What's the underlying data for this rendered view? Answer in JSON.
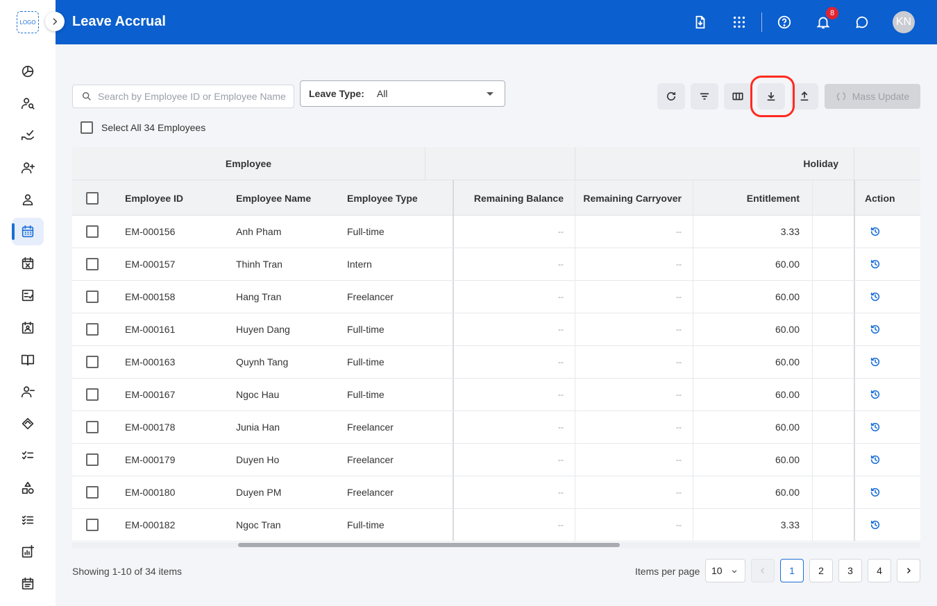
{
  "brand": {
    "logo_text": "LOGO",
    "primary_color": "#0b5fce",
    "accent_color": "#1a6fd6",
    "highlight_color": "#ff2a1f"
  },
  "header": {
    "title": "Leave Accrual",
    "notification_count": "8",
    "avatar_initials": "KN",
    "icons": [
      "file-download-icon",
      "apps-grid-icon",
      "help-icon",
      "bell-icon",
      "chat-icon"
    ]
  },
  "sidebar": {
    "items": [
      {
        "name": "dashboard",
        "icon": "pie-chart-icon"
      },
      {
        "name": "employee-search",
        "icon": "person-search-icon"
      },
      {
        "name": "approvals",
        "icon": "hand-check-icon"
      },
      {
        "name": "add-employee",
        "icon": "person-add-icon"
      },
      {
        "name": "profile",
        "icon": "person-icon"
      },
      {
        "name": "leave-accrual",
        "icon": "calendar-icon",
        "active": true
      },
      {
        "name": "leave-cancel",
        "icon": "calendar-x-icon"
      },
      {
        "name": "checklist",
        "icon": "checklist-icon"
      },
      {
        "name": "badge",
        "icon": "id-badge-icon"
      },
      {
        "name": "handbook",
        "icon": "book-icon"
      },
      {
        "name": "remove-employee",
        "icon": "person-remove-icon"
      },
      {
        "name": "deals",
        "icon": "handshake-icon"
      },
      {
        "name": "tasks",
        "icon": "task-list-icon"
      },
      {
        "name": "assets",
        "icon": "shapes-icon"
      },
      {
        "name": "rules",
        "icon": "rule-list-icon"
      },
      {
        "name": "reports",
        "icon": "chart-add-icon"
      },
      {
        "name": "events",
        "icon": "event-note-icon"
      }
    ]
  },
  "toolbar": {
    "search_placeholder": "Search by Employee ID or Employee Name",
    "leave_type_label": "Leave Type:",
    "leave_type_value": "All",
    "mass_update_label": "Mass Update",
    "select_all_label": "Select All 34 Employees"
  },
  "table": {
    "group_headers": {
      "employee": "Employee",
      "blank": "",
      "holiday": "Holiday"
    },
    "columns": {
      "id": "Employee ID",
      "name": "Employee Name",
      "type": "Employee Type",
      "remaining_balance": "Remaining Balance",
      "remaining_carryover": "Remaining Carryover",
      "entitlement": "Entitlement",
      "action": "Action"
    },
    "rows": [
      {
        "id": "EM-000156",
        "name": "Anh Pham",
        "type": "Full-time",
        "remaining_balance": "--",
        "remaining_carryover": "--",
        "entitlement": "3.33"
      },
      {
        "id": "EM-000157",
        "name": "Thinh Tran",
        "type": "Intern",
        "remaining_balance": "--",
        "remaining_carryover": "--",
        "entitlement": "60.00"
      },
      {
        "id": "EM-000158",
        "name": "Hang Tran",
        "type": "Freelancer",
        "remaining_balance": "--",
        "remaining_carryover": "--",
        "entitlement": "60.00"
      },
      {
        "id": "EM-000161",
        "name": "Huyen Dang",
        "type": "Full-time",
        "remaining_balance": "--",
        "remaining_carryover": "--",
        "entitlement": "60.00"
      },
      {
        "id": "EM-000163",
        "name": "Quynh Tang",
        "type": "Full-time",
        "remaining_balance": "--",
        "remaining_carryover": "--",
        "entitlement": "60.00"
      },
      {
        "id": "EM-000167",
        "name": "Ngoc Hau",
        "type": "Full-time",
        "remaining_balance": "--",
        "remaining_carryover": "--",
        "entitlement": "60.00"
      },
      {
        "id": "EM-000178",
        "name": "Junia Han",
        "type": "Freelancer",
        "remaining_balance": "--",
        "remaining_carryover": "--",
        "entitlement": "60.00"
      },
      {
        "id": "EM-000179",
        "name": "Duyen Ho",
        "type": "Freelancer",
        "remaining_balance": "--",
        "remaining_carryover": "--",
        "entitlement": "60.00"
      },
      {
        "id": "EM-000180",
        "name": "Duyen PM",
        "type": "Freelancer",
        "remaining_balance": "--",
        "remaining_carryover": "--",
        "entitlement": "60.00"
      },
      {
        "id": "EM-000182",
        "name": "Ngoc Tran",
        "type": "Full-time",
        "remaining_balance": "--",
        "remaining_carryover": "--",
        "entitlement": "3.33"
      }
    ]
  },
  "pagination": {
    "showing_text": "Showing 1-10 of 34 items",
    "items_per_page_label": "Items per page",
    "items_per_page_value": "10",
    "pages": [
      "1",
      "2",
      "3",
      "4"
    ],
    "current_page": "1"
  }
}
